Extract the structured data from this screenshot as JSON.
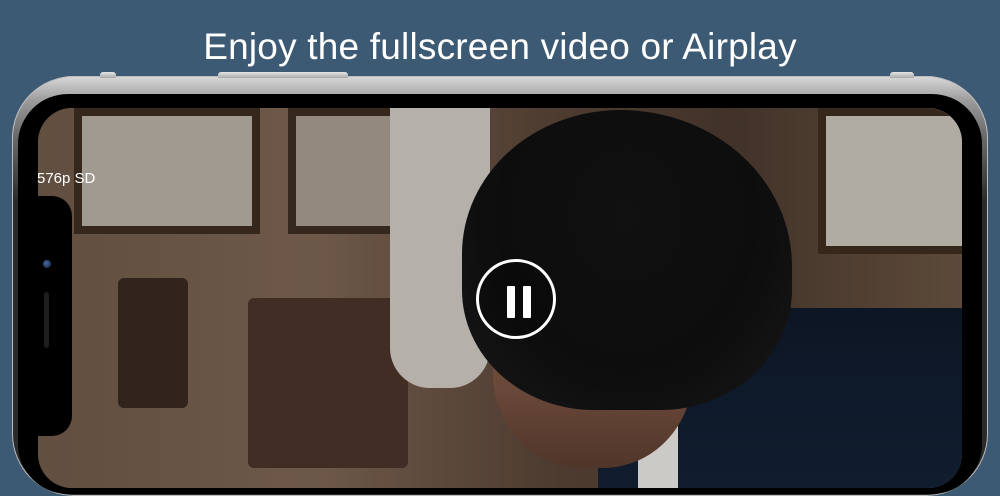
{
  "headline": "Enjoy the fullscreen video or Airplay",
  "player": {
    "quality_label": "576p SD",
    "state": "playing",
    "control_icon": "pause-icon"
  },
  "colors": {
    "background": "#3d5a74",
    "text": "#ffffff"
  }
}
